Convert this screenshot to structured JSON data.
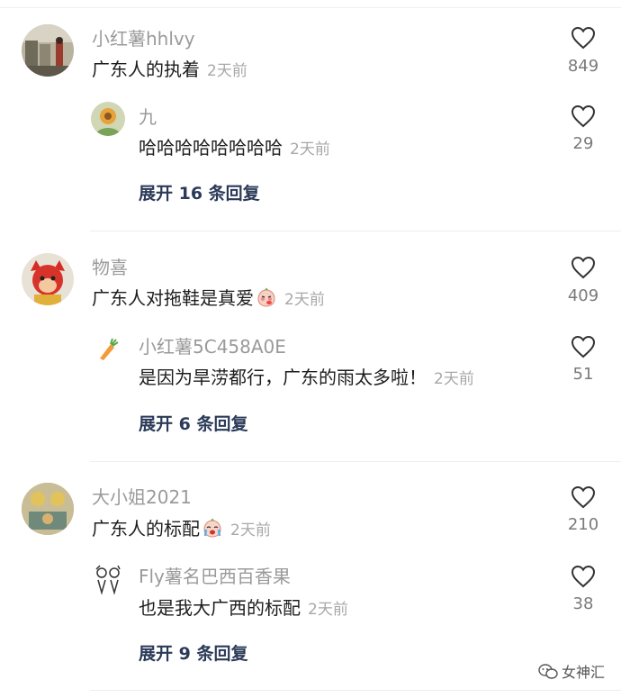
{
  "threads": [
    {
      "user": "小红薯hhlvy",
      "text": "广东人的执着",
      "time": "2天前",
      "likes": "849",
      "reply": {
        "user": "九",
        "text": "哈哈哈哈哈哈哈哈",
        "time": "2天前",
        "likes": "29"
      },
      "expand_label": "展开 16 条回复"
    },
    {
      "user": "物喜",
      "text": "广东人对拖鞋是真爱",
      "time": "2天前",
      "likes": "409",
      "reply": {
        "user": "小红薯5C458A0E",
        "text": "是因为旱涝都行，广东的雨太多啦！",
        "time": "2天前",
        "likes": "51"
      },
      "expand_label": "展开 6 条回复"
    },
    {
      "user": "大小姐2021",
      "text": "广东人的标配",
      "time": "2天前",
      "likes": "210",
      "reply": {
        "user": "Fly薯名巴西百香果",
        "text": "也是我大广西的标配",
        "time": "2天前",
        "likes": "38"
      },
      "expand_label": "展开 9 条回复"
    }
  ],
  "watermark": "女神汇",
  "icons": {
    "like": "heart-outline-icon",
    "emoji_shy": "blushing-face-emoji",
    "emoji_cry": "crying-face-emoji",
    "watermark": "wechat-icon"
  },
  "colors": {
    "username": "#9a9a9a",
    "comment_text": "#1d1d1d",
    "timestamp": "#a8a8a8",
    "expand_link": "#2b3a58",
    "divider": "#eeeeee"
  }
}
